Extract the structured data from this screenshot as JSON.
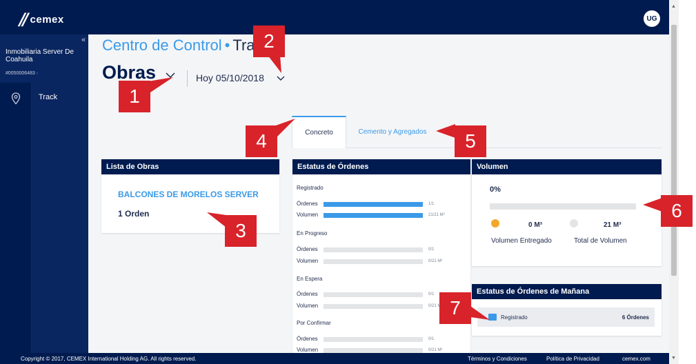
{
  "header": {
    "brand": "cemex",
    "avatar_initials": "UG"
  },
  "sidebar": {
    "account_name": "Inmobiliaria Server De Coahuila",
    "account_number": "#0050006483",
    "account_arrow": "›",
    "collapse": "«",
    "items": [
      {
        "label": "Track",
        "icon": "location-pin-icon"
      }
    ]
  },
  "page": {
    "app_title": "Centro de Control",
    "app_separator": "•",
    "app_title_rest": "Track",
    "title": "Obras",
    "date": "Hoy 05/10/2018"
  },
  "tabs": [
    {
      "label": "Concreto",
      "active": true
    },
    {
      "label": "Cemento y Agregados",
      "active": false
    }
  ],
  "lista_obras": {
    "header": "Lista de Obras",
    "items": [
      {
        "name": "BALCONES DE MORELOS SERVER",
        "orders": "1 Orden"
      }
    ]
  },
  "estatus_ordenes": {
    "header": "Estatus de Órdenes",
    "groups": [
      {
        "title": "Registrado",
        "rows": [
          {
            "label": "Órdenes",
            "value": "1/1",
            "fill": 1
          },
          {
            "label": "Volumen",
            "value": "21/21 M³",
            "fill": 1
          }
        ]
      },
      {
        "title": "En Progreso",
        "rows": [
          {
            "label": "Órdenes",
            "value": "0/1",
            "fill": 0
          },
          {
            "label": "Volumen",
            "value": "0/21 M³",
            "fill": 0
          }
        ]
      },
      {
        "title": "En Espera",
        "rows": [
          {
            "label": "Órdenes",
            "value": "0/1",
            "fill": 0
          },
          {
            "label": "Volumen",
            "value": "0/21 M³",
            "fill": 0
          }
        ]
      },
      {
        "title": "Por Confirmar",
        "rows": [
          {
            "label": "Órdenes",
            "value": "0/1",
            "fill": 0
          },
          {
            "label": "Volumen",
            "value": "0/21 M³",
            "fill": 0
          }
        ]
      }
    ]
  },
  "volumen": {
    "header": "Volumen",
    "percent": "0%",
    "entregado_value": "0 M³",
    "entregado_label": "Volumen Entregado",
    "total_value": "21 M³",
    "total_label": "Total de Volumen"
  },
  "manana": {
    "header": "Estatus de Órdenes de Mañana",
    "row_label": "Registrado",
    "row_count": "6 Órdenes"
  },
  "footer": {
    "copyright": "Copyright © 2017, CEMEX International Holding AG. All rights reserved.",
    "terms": "Términos y Condiciones",
    "privacy": "Política de Privacidad",
    "site": "cemex.com"
  },
  "callouts": [
    "1",
    "2",
    "3",
    "4",
    "5",
    "6",
    "7"
  ],
  "colors": {
    "navy": "#001b4f",
    "accent_blue": "#3a9ae8",
    "callout_red": "#d8232a",
    "orange": "#f2a82a"
  }
}
